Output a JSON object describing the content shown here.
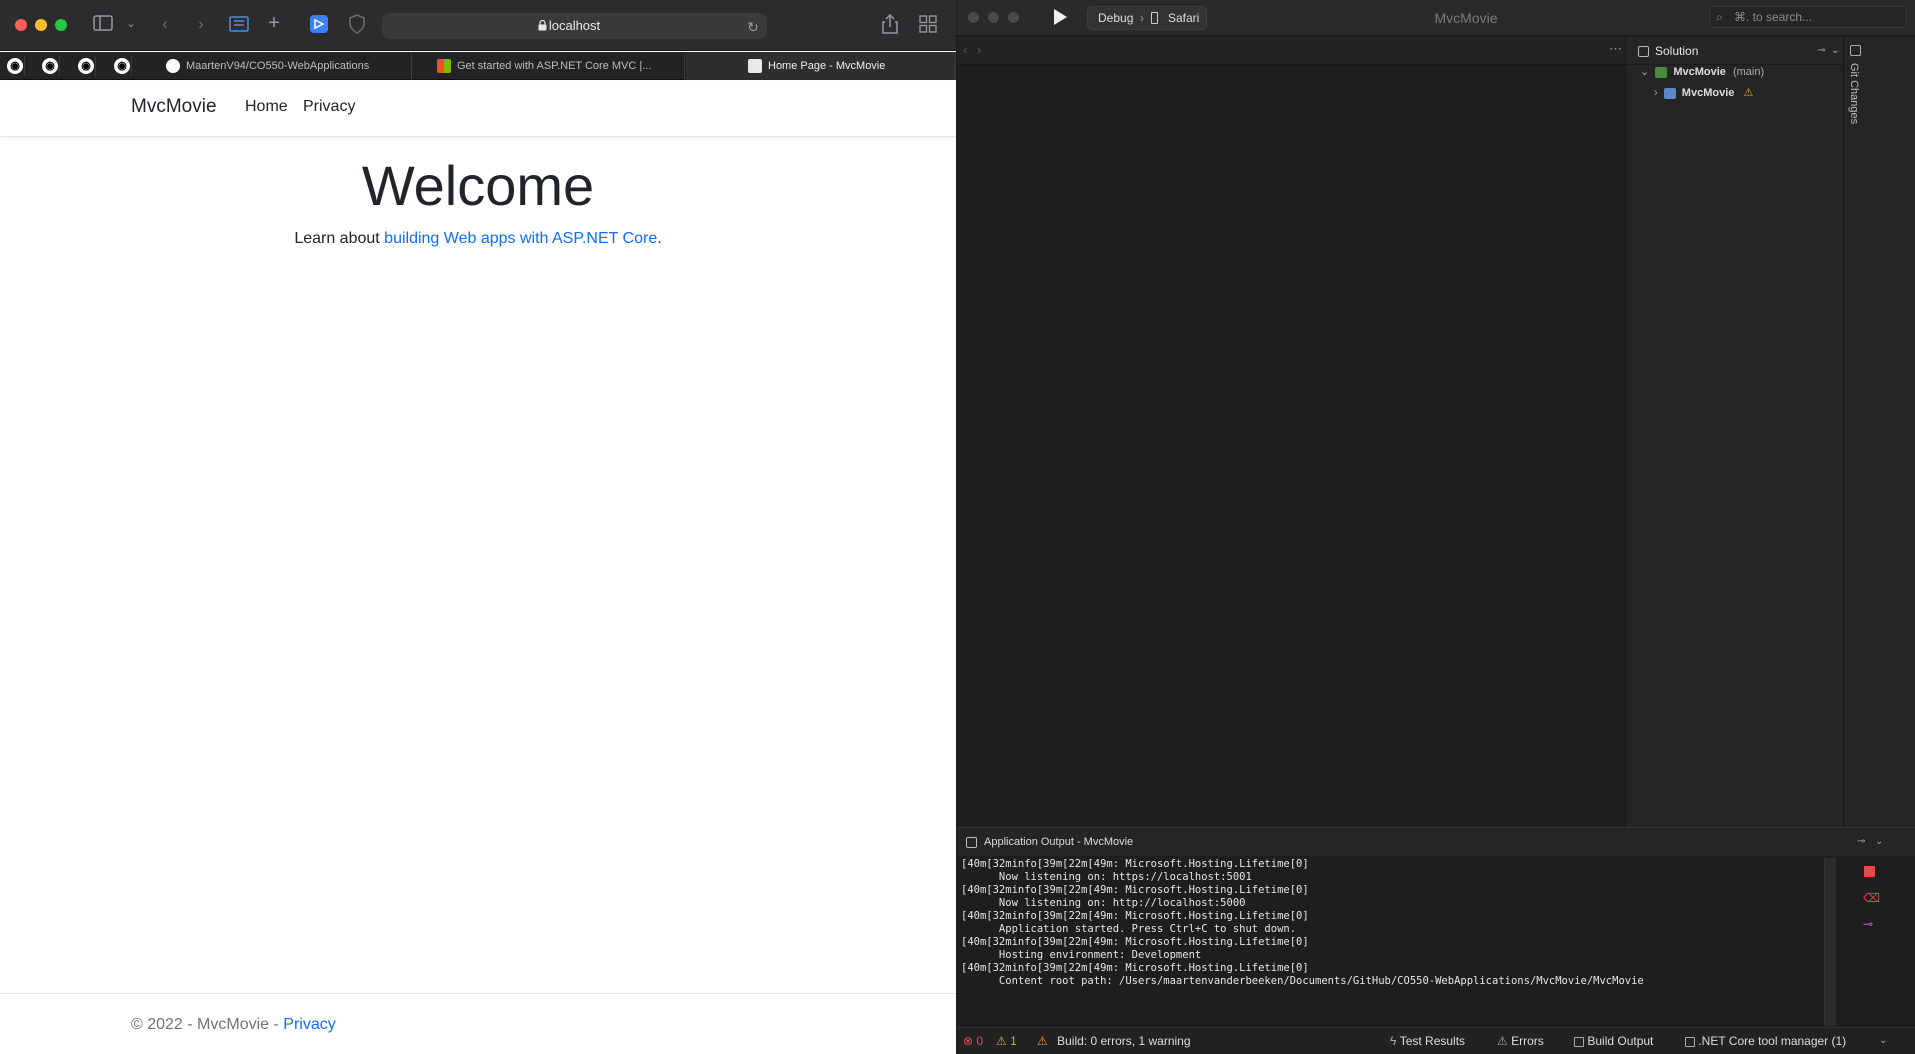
{
  "safari": {
    "address": "localhost",
    "tabs": [
      {
        "label": "MaartenV94/CO550-WebApplications"
      },
      {
        "label": "Get started with ASP.NET Core MVC |..."
      },
      {
        "label": "Home Page - MvcMovie"
      }
    ],
    "pinned_tab_icon": "github-icon"
  },
  "page": {
    "brand": "MvcMovie",
    "nav": [
      "Home",
      "Privacy"
    ],
    "heading": "Welcome",
    "lead_prefix": "Learn about ",
    "lead_link": "building Web apps with ASP.NET Core",
    "lead_suffix": ".",
    "footer_text": "© 2022 - MvcMovie - ",
    "footer_link": "Privacy"
  },
  "ide": {
    "run_config": "Debug",
    "run_target": "Safari",
    "title": "MvcMovie",
    "search_placeholder": "⌘. to search...",
    "solution_header": "Solution",
    "solution_root": "MvcMovie",
    "solution_branch": "(main)",
    "solution_project": "MvcMovie",
    "git_changes": "Git Changes",
    "output_title": "Application Output - MvcMovie",
    "output_lines": "[40m[32minfo[39m[22m[49m: Microsoft.Hosting.Lifetime[0]\n      Now listening on: https://localhost:5001\n[40m[32minfo[39m[22m[49m: Microsoft.Hosting.Lifetime[0]\n      Now listening on: http://localhost:5000\n[40m[32minfo[39m[22m[49m: Microsoft.Hosting.Lifetime[0]\n      Application started. Press Ctrl+C to shut down.\n[40m[32minfo[39m[22m[49m: Microsoft.Hosting.Lifetime[0]\n      Hosting environment: Development\n[40m[32minfo[39m[22m[49m: Microsoft.Hosting.Lifetime[0]\n      Content root path: /Users/maartenvanderbeeken/Documents/GitHub/CO550-WebApplications/MvcMovie/MvcMovie",
    "status": {
      "errors": "0",
      "warnings": "1",
      "build": "Build: 0 errors, 1 warning",
      "tabs": [
        "Test Results",
        "Errors",
        "Build Output",
        ".NET Core tool manager (1)"
      ]
    }
  },
  "colors": {
    "link": "#0d6efd",
    "close": "#ff5f57",
    "minimize": "#febc2e",
    "zoom": "#28c840",
    "warning": "#e8a33d",
    "error": "#e5484d"
  }
}
